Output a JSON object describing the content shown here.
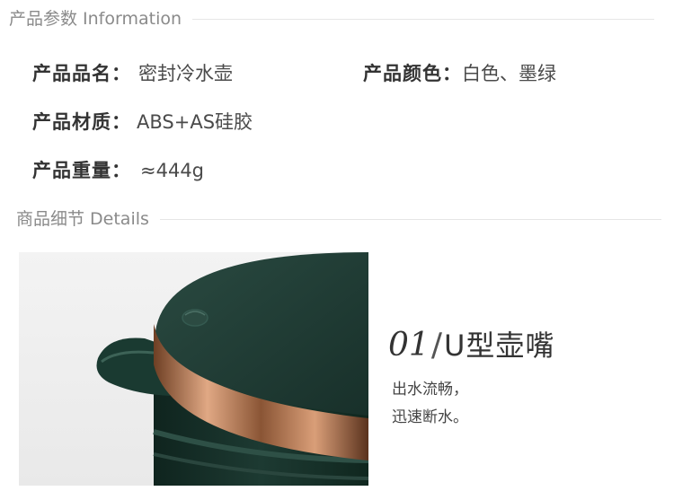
{
  "info_section": {
    "title": "产品参数 Information"
  },
  "specs": {
    "name_label": "产品品名：",
    "name_value": "密封冷水壶",
    "color_label": "产品颜色：",
    "color_value": "白色、墨绿",
    "material_label": "产品材质：",
    "material_value": "ABS+AS硅胶",
    "weight_label": "产品重量：",
    "weight_value": "≈444g"
  },
  "details_section": {
    "title": "商品细节 Details"
  },
  "feature": {
    "number": "01",
    "slash": "/",
    "name": "U型壶嘴",
    "desc_line1": "出水流畅，",
    "desc_line2": "迅速断水。"
  },
  "colors": {
    "lid_green": "#1f3b33",
    "body_green": "#173129",
    "copper_ring": "#b97a52",
    "rule_gray": "#e6e6e6"
  }
}
